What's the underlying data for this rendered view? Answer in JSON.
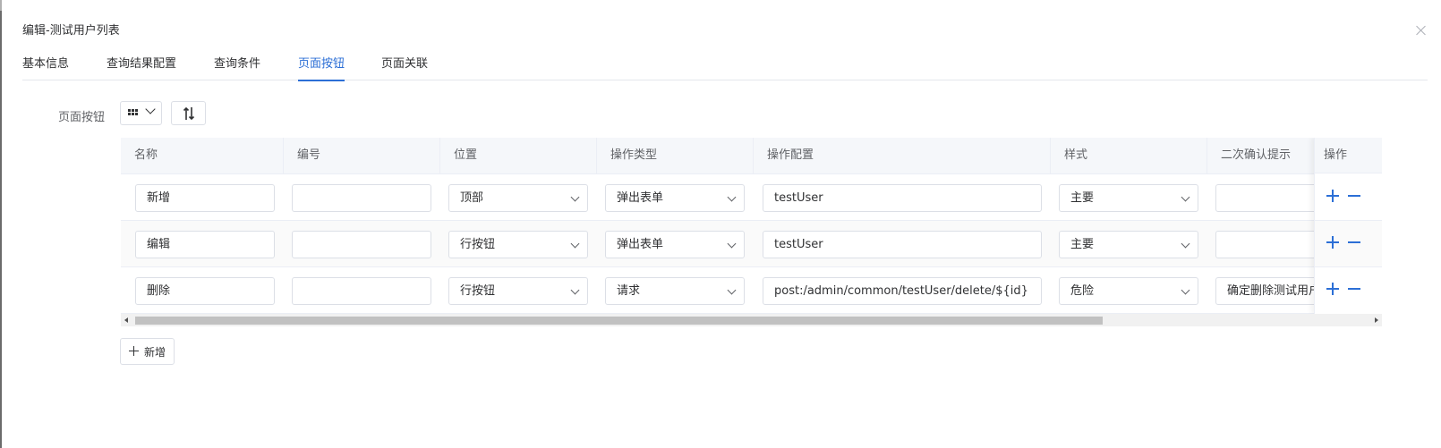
{
  "dialog": {
    "title": "编辑-测试用户列表"
  },
  "tabs": [
    {
      "label": "基本信息"
    },
    {
      "label": "查询结果配置"
    },
    {
      "label": "查询条件"
    },
    {
      "label": "页面按钮",
      "active": true
    },
    {
      "label": "页面关联"
    }
  ],
  "form": {
    "label": "页面按钮",
    "toolbar_icons": [
      "grid-icon",
      "chevron-down-icon",
      "sort-icon"
    ]
  },
  "table": {
    "columns": [
      "名称",
      "编号",
      "位置",
      "操作类型",
      "操作配置",
      "样式",
      "二次确认提示",
      "操作"
    ],
    "rows": [
      {
        "name": "新增",
        "code": "",
        "position": "顶部",
        "action_type": "弹出表单",
        "action_config": "testUser",
        "style": "主要",
        "confirm": ""
      },
      {
        "name": "编辑",
        "code": "",
        "position": "行按钮",
        "action_type": "弹出表单",
        "action_config": "testUser",
        "style": "主要",
        "confirm": ""
      },
      {
        "name": "删除",
        "code": "",
        "position": "行按钮",
        "action_type": "请求",
        "action_config": "post:/admin/common/testUser/delete/${id}",
        "style": "危险",
        "confirm": "确定删除测试用户"
      }
    ]
  },
  "add_button": {
    "label": "新增"
  },
  "colors": {
    "accent": "#2c6fd6",
    "border": "#dcdfe6",
    "header_bg": "#f5f7fa"
  }
}
